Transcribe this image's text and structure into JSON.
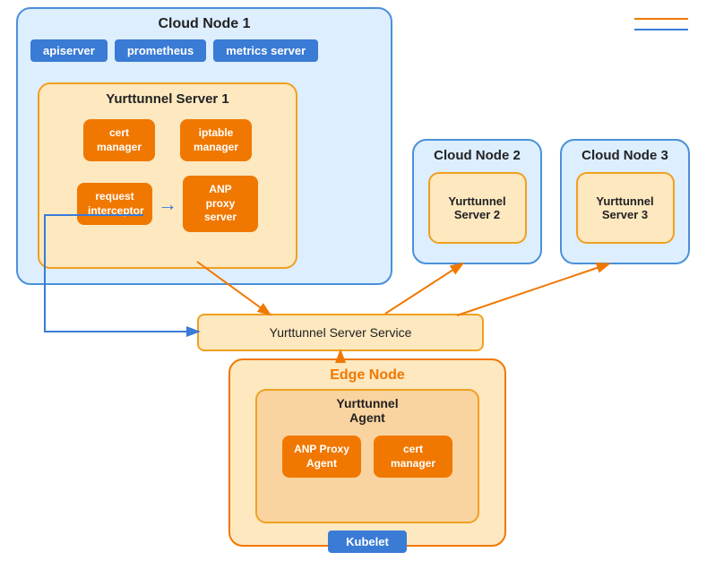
{
  "cloudNode1": {
    "title": "Cloud Node 1",
    "apiserver": "apiserver",
    "prometheus": "prometheus",
    "metricsServer": "metrics server",
    "yurtServer1": {
      "title": "Yurttunnel Server 1",
      "certManager": "cert\nmanager",
      "iptableManager": "iptable\nmanager",
      "requestInterceptor": "request\ninterceptor",
      "anpProxyServer": "ANP proxy\nserver"
    }
  },
  "cloudNode2": {
    "title": "Cloud Node 2",
    "yurtServer2": "Yurttunnel\nServer 2"
  },
  "cloudNode3": {
    "title": "Cloud Node 3",
    "yurtServer3": "Yurttunnel\nServer 3"
  },
  "yurtService": "Yurttunnel Server Service",
  "edgeNode": {
    "title": "Edge Node",
    "yurtAgent": {
      "title": "Yurttunnel\nAgent",
      "anpProxyAgent": "ANP Proxy\nAgent",
      "certManager": "cert\nmanager"
    },
    "kubelet": "Kubelet"
  }
}
